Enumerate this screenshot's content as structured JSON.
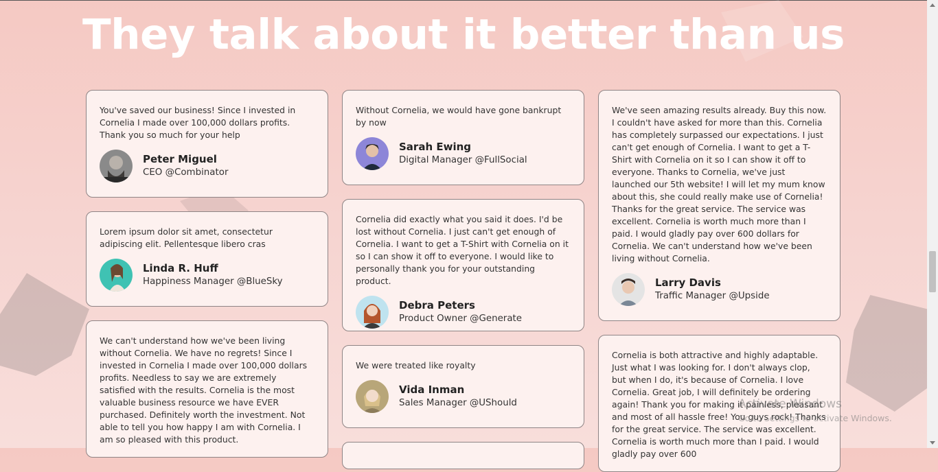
{
  "heading": "They talk about it better than us",
  "testimonials": [
    {
      "quote": "You've saved our business! Since I invested in Cornelia I made over 100,000 dollars profits. Thank you so much for your help",
      "name": "Peter Miguel",
      "role": "CEO @Combinator"
    },
    {
      "quote": "Lorem ipsum dolor sit amet, consectetur adipiscing elit. Pellentesque libero cras",
      "name": "Linda R. Huff",
      "role": "Happiness Manager @BlueSky"
    },
    {
      "quote": "We can't understand how we've been living without Cornelia. We have no regrets! Since I invested in Cornelia I made over 100,000 dollars profits. Needless to say we are extremely satisfied with the results. Cornelia is the most valuable business resource we have EVER purchased. Definitely worth the investment. Not able to tell you how happy I am with Cornelia. I am so pleased with this product."
    },
    {
      "quote": "Without Cornelia, we would have gone bankrupt by now",
      "name": "Sarah Ewing",
      "role": "Digital Manager @FullSocial"
    },
    {
      "quote": "Cornelia did exactly what you said it does. I'd be lost without Cornelia. I just can't get enough of Cornelia. I want to get a T-Shirt with Cornelia on it so I can show it off to everyone. I would like to personally thank you for your outstanding product.",
      "name": "Debra Peters",
      "role": "Product Owner @Generate"
    },
    {
      "quote": "We were treated like royalty",
      "name": "Vida Inman",
      "role": "Sales Manager @UShould"
    },
    {
      "quote": "We've seen amazing results already. Buy this now. I couldn't have asked for more than this. Cornelia has completely surpassed our expectations. I just can't get enough of Cornelia. I want to get a T-Shirt with Cornelia on it so I can show it off to everyone. Thanks to Cornelia, we've just launched our 5th website! I will let my mum know about this, she could really make use of Cornelia!\nThanks for the great service. The service was excellent. Cornelia is worth much more than I paid. I would gladly pay over 600 dollars for Cornelia. We can't understand how we've been living without Cornelia.",
      "name": "Larry Davis",
      "role": "Traffic Manager @Upside"
    },
    {
      "quote": "Cornelia is both attractive and highly adaptable. Just what I was looking for. I don't always clop, but when I do, it's because of Cornelia. I love Cornelia. Great job, I will definitely be ordering again! Thank you for making it painless, pleasant and most of all hassle free! You guys rock! Thanks for the great service. The service was excellent. Cornelia is worth much more than I paid. I would gladly pay over 600"
    }
  ],
  "watermark": {
    "line1": "Activate Windows",
    "line2": "Go to Settings to activate Windows."
  },
  "colors": {
    "card_bg": "#fdf1ef",
    "card_border": "#8e8485",
    "heading": "#ffffff"
  }
}
